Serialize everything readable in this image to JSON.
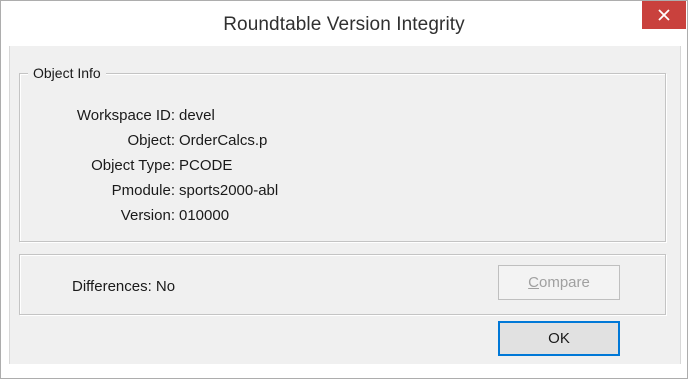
{
  "window": {
    "title": "Roundtable Version Integrity",
    "close_icon": "close-icon",
    "close_color": "#c9413d"
  },
  "object_info": {
    "legend": "Object Info",
    "fields": [
      {
        "label": "Workspace ID:",
        "value": "devel"
      },
      {
        "label": "Object:",
        "value": "OrderCalcs.p"
      },
      {
        "label": "Object Type:",
        "value": "PCODE"
      },
      {
        "label": "Pmodule:",
        "value": "sports2000-abl"
      },
      {
        "label": "Version:",
        "value": "010000"
      }
    ]
  },
  "differences": {
    "text": "Differences: No"
  },
  "buttons": {
    "compare_mnemonic": "C",
    "compare_rest": "ompare",
    "compare_enabled": false,
    "ok_label": "OK"
  }
}
